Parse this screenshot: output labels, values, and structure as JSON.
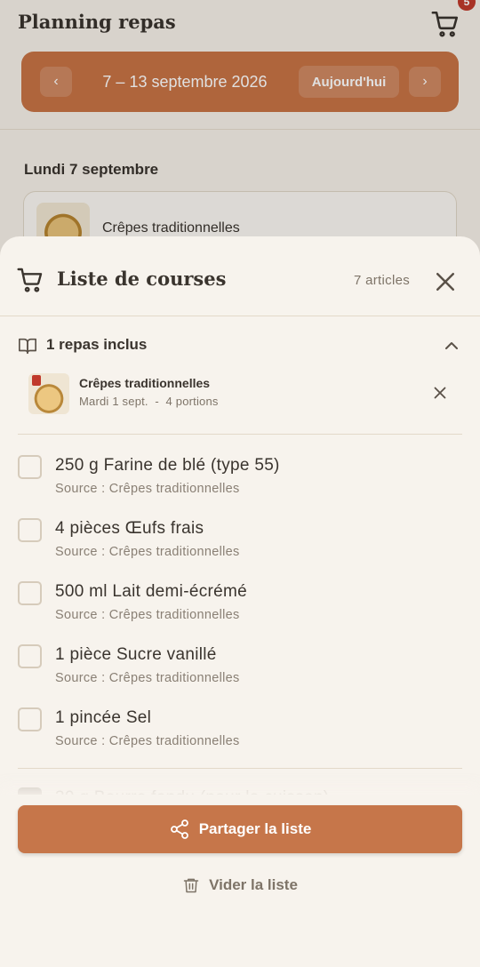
{
  "background": {
    "title": "Planning repas",
    "cart_badge": "5",
    "week_label": "7 – 13 septembre 2026",
    "today_label": "Aujourd'hui",
    "day_title": "Lundi 7 septembre",
    "meal_name": "Crêpes traditionnelles"
  },
  "sheet": {
    "title": "Liste de courses",
    "count": "7 articles",
    "meals_header": "1 repas inclus",
    "meal": {
      "name": "Crêpes traditionnelles",
      "meta": "Mardi 1 sept.  -  4 portions"
    },
    "items": [
      {
        "name": "250 g Farine de blé (type 55)",
        "source": "Source : Crêpes traditionnelles",
        "checked": false
      },
      {
        "name": "4 pièces Œufs frais",
        "source": "Source : Crêpes traditionnelles",
        "checked": false
      },
      {
        "name": "500 ml Lait demi-écrémé",
        "source": "Source : Crêpes traditionnelles",
        "checked": false
      },
      {
        "name": "1 pièce Sucre vanillé",
        "source": "Source : Crêpes traditionnelles",
        "checked": false
      },
      {
        "name": "1 pincée Sel",
        "source": "Source : Crêpes traditionnelles",
        "checked": false
      }
    ],
    "partial_item": {
      "name": "30 g Beurre fondu (pour la cuisson)",
      "checked": true
    },
    "share_label": "Partager la liste",
    "clear_label": "Vider la liste"
  },
  "colors": {
    "accent": "#c6764a",
    "background": "#f7f3ed",
    "text": "#3a342e",
    "muted": "#8a8075"
  }
}
